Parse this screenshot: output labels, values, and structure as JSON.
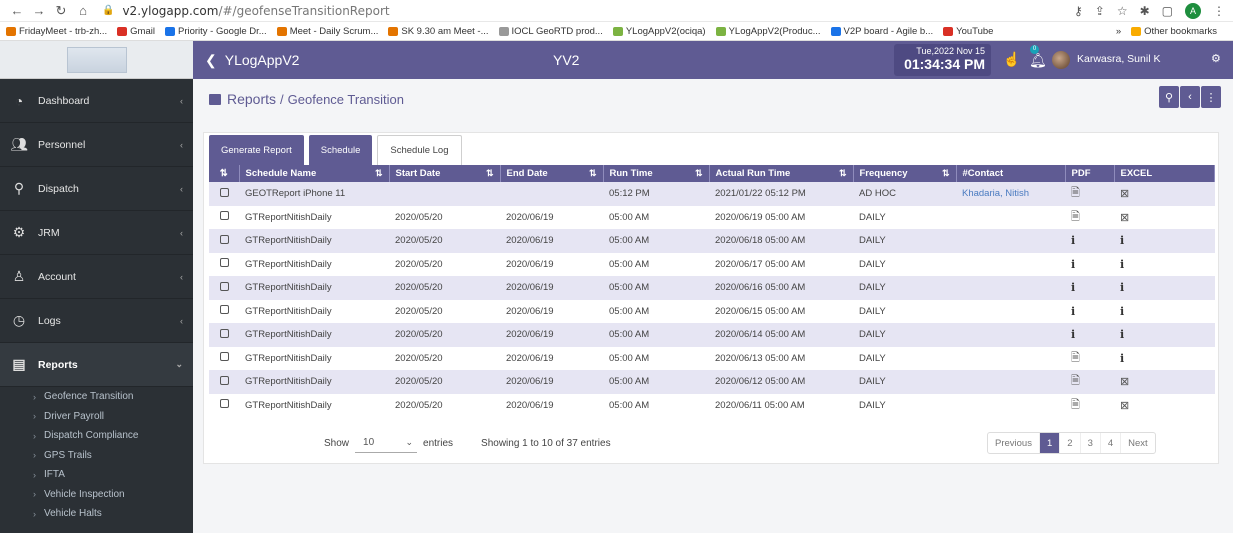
{
  "browser": {
    "url_host": "v2.ylogapp.com",
    "url_path": "/#/geofenseTransitionReport",
    "bookmarks": [
      {
        "label": "FridayMeet - trb-zh...",
        "color": "#e37400"
      },
      {
        "label": "Gmail",
        "color": "#d93025"
      },
      {
        "label": "Priority - Google Dr...",
        "color": "#1a73e8"
      },
      {
        "label": "Meet - Daily Scrum...",
        "color": "#e37400"
      },
      {
        "label": "SK 9.30 am Meet -...",
        "color": "#e37400"
      },
      {
        "label": "IOCL GeoRTD prod...",
        "color": "#999999"
      },
      {
        "label": "YLogAppV2(ociqa)",
        "color": "#7cb342"
      },
      {
        "label": "YLogAppV2(Produc...",
        "color": "#7cb342"
      },
      {
        "label": "V2P board - Agile b...",
        "color": "#1a73e8"
      },
      {
        "label": "YouTube",
        "color": "#d93025"
      }
    ],
    "more_bookmarks": "»",
    "other_bookmarks": "Other bookmarks",
    "profile_initial": "A"
  },
  "header": {
    "app_title": "YLogAppV2",
    "center_title": "YV2",
    "date": "Tue,2022 Nov 15",
    "time": "01:34:34 PM",
    "notification_count": "0",
    "user_name": "Karwasra, Sunil K"
  },
  "sidebar": {
    "items": [
      {
        "label": "Dashboard",
        "icon": "pie-chart-icon"
      },
      {
        "label": "Personnel",
        "icon": "users-icon"
      },
      {
        "label": "Dispatch",
        "icon": "map-marker-icon"
      },
      {
        "label": "JRM",
        "icon": "gear-icon"
      },
      {
        "label": "Account",
        "icon": "user-icon"
      },
      {
        "label": "Logs",
        "icon": "clock-icon"
      },
      {
        "label": "Reports",
        "icon": "report-icon"
      }
    ],
    "sub_items": [
      "Geofence Transition",
      "Driver Payroll",
      "Dispatch Compliance",
      "GPS Trails",
      "IFTA",
      "Vehicle Inspection",
      "Vehicle Halts"
    ]
  },
  "page": {
    "title": "Reports",
    "separator": "/",
    "subtitle": "Geofence Transition"
  },
  "tabs": [
    "Generate Report",
    "Schedule",
    "Schedule Log"
  ],
  "table": {
    "columns": [
      "Schedule Name",
      "Start Date",
      "End Date",
      "Run Time",
      "Actual Run Time",
      "Frequency",
      "#Contact",
      "PDF",
      "EXCEL"
    ],
    "rows": [
      {
        "name": "GEOTReport iPhone 11",
        "start": "",
        "end": "",
        "run": "05:12 PM",
        "actual": "2021/01/22 05:12 PM",
        "freq": "AD HOC",
        "contact": "Khadaria, Nitish",
        "pdf": "file",
        "excel": "file"
      },
      {
        "name": "GTReportNitishDaily",
        "start": "2020/05/20",
        "end": "2020/06/19",
        "run": "05:00 AM",
        "actual": "2020/06/19 05:00 AM",
        "freq": "DAILY",
        "contact": "",
        "pdf": "file",
        "excel": "file"
      },
      {
        "name": "GTReportNitishDaily",
        "start": "2020/05/20",
        "end": "2020/06/19",
        "run": "05:00 AM",
        "actual": "2020/06/18 05:00 AM",
        "freq": "DAILY",
        "contact": "",
        "pdf": "info",
        "excel": "info"
      },
      {
        "name": "GTReportNitishDaily",
        "start": "2020/05/20",
        "end": "2020/06/19",
        "run": "05:00 AM",
        "actual": "2020/06/17 05:00 AM",
        "freq": "DAILY",
        "contact": "",
        "pdf": "info",
        "excel": "info"
      },
      {
        "name": "GTReportNitishDaily",
        "start": "2020/05/20",
        "end": "2020/06/19",
        "run": "05:00 AM",
        "actual": "2020/06/16 05:00 AM",
        "freq": "DAILY",
        "contact": "",
        "pdf": "info",
        "excel": "info"
      },
      {
        "name": "GTReportNitishDaily",
        "start": "2020/05/20",
        "end": "2020/06/19",
        "run": "05:00 AM",
        "actual": "2020/06/15 05:00 AM",
        "freq": "DAILY",
        "contact": "",
        "pdf": "info",
        "excel": "info"
      },
      {
        "name": "GTReportNitishDaily",
        "start": "2020/05/20",
        "end": "2020/06/19",
        "run": "05:00 AM",
        "actual": "2020/06/14 05:00 AM",
        "freq": "DAILY",
        "contact": "",
        "pdf": "info",
        "excel": "info"
      },
      {
        "name": "GTReportNitishDaily",
        "start": "2020/05/20",
        "end": "2020/06/19",
        "run": "05:00 AM",
        "actual": "2020/06/13 05:00 AM",
        "freq": "DAILY",
        "contact": "",
        "pdf": "file",
        "excel": "info"
      },
      {
        "name": "GTReportNitishDaily",
        "start": "2020/05/20",
        "end": "2020/06/19",
        "run": "05:00 AM",
        "actual": "2020/06/12 05:00 AM",
        "freq": "DAILY",
        "contact": "",
        "pdf": "file",
        "excel": "file"
      },
      {
        "name": "GTReportNitishDaily",
        "start": "2020/05/20",
        "end": "2020/06/19",
        "run": "05:00 AM",
        "actual": "2020/06/11 05:00 AM",
        "freq": "DAILY",
        "contact": "",
        "pdf": "file",
        "excel": "file"
      }
    ]
  },
  "footer": {
    "show_label": "Show",
    "entries_value": "10",
    "entries_label": "entries",
    "showing_text": "Showing 1 to 10 of 37 entries",
    "pager": [
      "Previous",
      "1",
      "2",
      "3",
      "4",
      "Next"
    ],
    "current_page": "1"
  }
}
